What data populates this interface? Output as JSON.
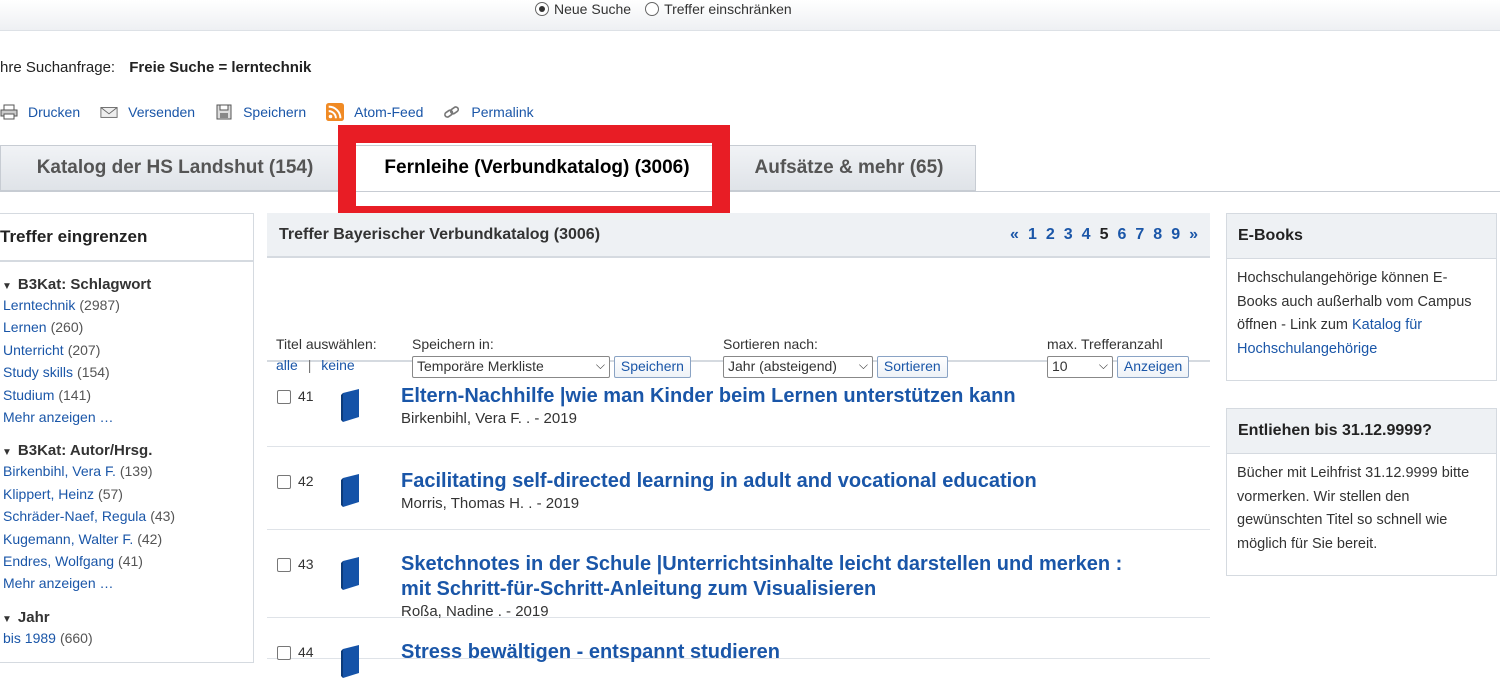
{
  "topbar": {
    "new_search": "Neue Suche",
    "restrict": "Treffer einschränken"
  },
  "query": {
    "label": "hre Suchanfrage:",
    "value": "Freie Suche = lerntechnik"
  },
  "actions": [
    "Drucken",
    "Versenden",
    "Speichern",
    "Atom-Feed",
    "Permalink"
  ],
  "tabs": [
    {
      "label": "Katalog der HS Landshut (154)"
    },
    {
      "label": "Fernleihe (Verbundkatalog) (3006)"
    },
    {
      "label": "Aufsätze & mehr (65)"
    }
  ],
  "highlight_color": "#e81d25",
  "left": {
    "title": "Treffer eingrenzen",
    "facets": [
      {
        "title": "B3Kat: Schlagwort",
        "items": [
          {
            "label": "Lerntechnik",
            "count": "(2987)"
          },
          {
            "label": "Lernen",
            "count": "(260)"
          },
          {
            "label": "Unterricht",
            "count": "(207)"
          },
          {
            "label": "Study skills",
            "count": "(154)"
          },
          {
            "label": "Studium",
            "count": "(141)"
          },
          {
            "label": "Mehr anzeigen …",
            "count": ""
          }
        ]
      },
      {
        "title": "B3Kat: Autor/Hrsg.",
        "items": [
          {
            "label": "Birkenbihl, Vera F.",
            "count": "(139)"
          },
          {
            "label": "Klippert, Heinz",
            "count": "(57)"
          },
          {
            "label": "Schräder-Naef, Regula",
            "count": "(43)"
          },
          {
            "label": "Kugemann, Walter F.",
            "count": "(42)"
          },
          {
            "label": "Endres, Wolfgang",
            "count": "(41)"
          },
          {
            "label": "Mehr anzeigen …",
            "count": ""
          }
        ]
      },
      {
        "title": "Jahr",
        "items": [
          {
            "label": "bis 1989",
            "count": "(660)"
          }
        ]
      }
    ]
  },
  "center": {
    "title": "Treffer Bayerischer Verbundkatalog (3006)",
    "pager": {
      "prev": "«",
      "pages": [
        "1",
        "2",
        "3",
        "4",
        "5",
        "6",
        "7",
        "8",
        "9"
      ],
      "current": "5",
      "next": "»"
    },
    "controls": {
      "select_label": "Titel auswählen:",
      "select_all": "alle",
      "select_sep": "|",
      "select_none": "keine",
      "save_label": "Speichern in:",
      "save_value": "Temporäre Merkliste",
      "save_button": "Speichern",
      "sort_label": "Sortieren nach:",
      "sort_value": "Jahr (absteigend)",
      "sort_button": "Sortieren",
      "max_label": "max. Trefferanzahl",
      "max_value": "10",
      "max_button": "Anzeigen"
    },
    "results": [
      {
        "num": "41",
        "title_lines": [
          "Eltern-Nachhilfe |wie man Kinder beim Lernen unterstützen kann"
        ],
        "meta": "Birkenbihl, Vera F. . - 2019"
      },
      {
        "num": "42",
        "title_lines": [
          "Facilitating self-directed learning in adult and vocational education"
        ],
        "meta": "Morris, Thomas H. . - 2019"
      },
      {
        "num": "43",
        "title_lines": [
          "Sketchnotes in der Schule |Unterrichtsinhalte leicht darstellen und merken :",
          "mit Schritt-für-Schritt-Anleitung zum Visualisieren"
        ],
        "meta": "Roßa, Nadine . - 2019"
      },
      {
        "num": "44",
        "title_lines": [
          "Stress bewältigen - entspannt studieren"
        ],
        "meta": ""
      }
    ]
  },
  "right": [
    {
      "title": "E-Books",
      "text": "Hochschulangehörige können E-Books auch außerhalb vom Campus öffnen - Link zum",
      "link": "Katalog für Hochschulangehörige"
    },
    {
      "title": "Entliehen bis 31.12.9999?",
      "text": "Bücher mit Leihfrist 31.12.9999 bitte vormerken. Wir stellen den gewünschten Titel so schnell wie möglich für Sie bereit.",
      "link": ""
    }
  ]
}
